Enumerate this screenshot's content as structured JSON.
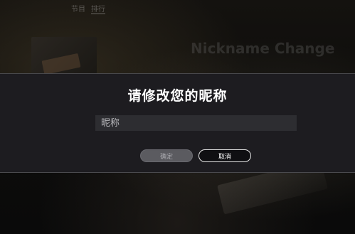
{
  "background": {
    "nav_items": [
      "节目",
      "排行"
    ],
    "title": "Nickname Change"
  },
  "dialog": {
    "title": "请修改您的昵称",
    "input": {
      "placeholder": "昵称",
      "value": ""
    },
    "confirm_label": "确定",
    "cancel_label": "取消"
  },
  "colors": {
    "dialog_bg": "#1d1c20",
    "input_bg": "#2d2d31",
    "confirm_bg": "#5b5b60",
    "cancel_border": "#e8e8e8"
  }
}
